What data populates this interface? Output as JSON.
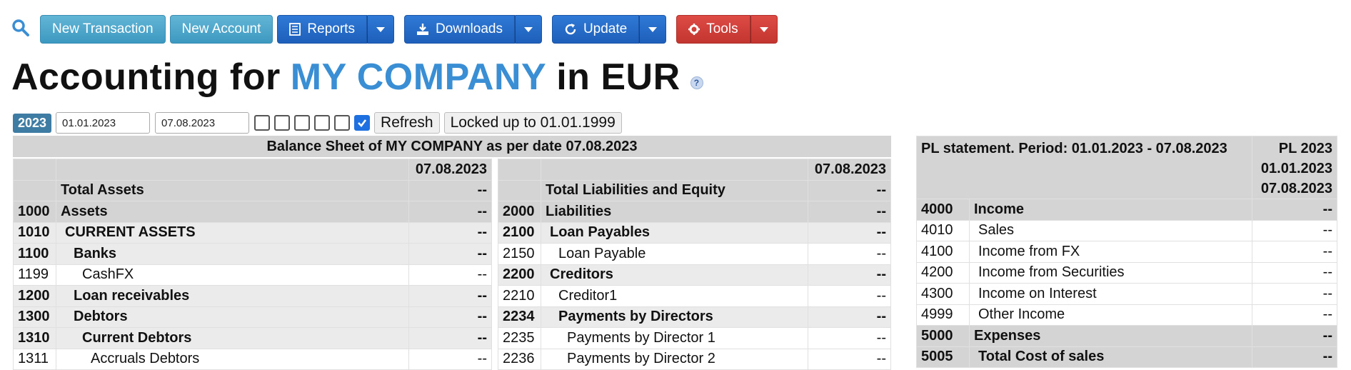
{
  "toolbar": {
    "new_transaction": "New Transaction",
    "new_account": "New Account",
    "reports": "Reports",
    "downloads": "Downloads",
    "update": "Update",
    "tools": "Tools"
  },
  "title": {
    "prefix": "Accounting for",
    "company": "MY COMPANY",
    "suffix": "in EUR",
    "help": "?"
  },
  "filters": {
    "year": "2023",
    "date_from": "01.01.2023",
    "date_to": "07.08.2023",
    "checkboxes": [
      false,
      false,
      false,
      false,
      false,
      true
    ],
    "refresh": "Refresh",
    "locked": "Locked up to 01.01.1999"
  },
  "balance_sheet": {
    "title": "Balance Sheet of MY COMPANY as per date 07.08.2023",
    "left": {
      "date_header": "07.08.2023",
      "rows": [
        {
          "code": "",
          "name": "Total Assets",
          "value": "--"
        },
        {
          "code": "1000",
          "name": "Assets",
          "value": "--"
        },
        {
          "code": "1010",
          "name": "CURRENT ASSETS",
          "value": "--"
        },
        {
          "code": "1100",
          "name": "Banks",
          "value": "--"
        },
        {
          "code": "1199",
          "name": "CashFX",
          "value": "--"
        },
        {
          "code": "1200",
          "name": "Loan receivables",
          "value": "--"
        },
        {
          "code": "1300",
          "name": "Debtors",
          "value": "--"
        },
        {
          "code": "1310",
          "name": "Current Debtors",
          "value": "--"
        },
        {
          "code": "1311",
          "name": "Accruals Debtors",
          "value": "--"
        }
      ]
    },
    "right": {
      "date_header": "07.08.2023",
      "rows": [
        {
          "code": "",
          "name": "Total Liabilities and Equity",
          "value": "--"
        },
        {
          "code": "2000",
          "name": "Liabilities",
          "value": "--"
        },
        {
          "code": "2100",
          "name": "Loan Payables",
          "value": "--"
        },
        {
          "code": "2150",
          "name": "Loan Payable",
          "value": "--"
        },
        {
          "code": "2200",
          "name": "Creditors",
          "value": "--"
        },
        {
          "code": "2210",
          "name": "Creditor1",
          "value": "--"
        },
        {
          "code": "2234",
          "name": "Payments by Directors",
          "value": "--"
        },
        {
          "code": "2235",
          "name": "Payments by Director 1",
          "value": "--"
        },
        {
          "code": "2236",
          "name": "Payments by Director 2",
          "value": "--"
        }
      ]
    }
  },
  "pl_statement": {
    "title": "PL statement. Period: 01.01.2023 - 07.08.2023",
    "col_header": [
      "PL 2023",
      "01.01.2023",
      "07.08.2023"
    ],
    "rows": [
      {
        "code": "4000",
        "name": "Income",
        "value": "--"
      },
      {
        "code": "4010",
        "name": "Sales",
        "value": "--"
      },
      {
        "code": "4100",
        "name": "Income from FX",
        "value": "--"
      },
      {
        "code": "4200",
        "name": "Income from Securities",
        "value": "--"
      },
      {
        "code": "4300",
        "name": "Income on Interest",
        "value": "--"
      },
      {
        "code": "4999",
        "name": "Other Income",
        "value": "--"
      },
      {
        "code": "5000",
        "name": "Expenses",
        "value": "--"
      },
      {
        "code": "5005",
        "name": "Total Cost of sales",
        "value": "--"
      }
    ]
  }
}
